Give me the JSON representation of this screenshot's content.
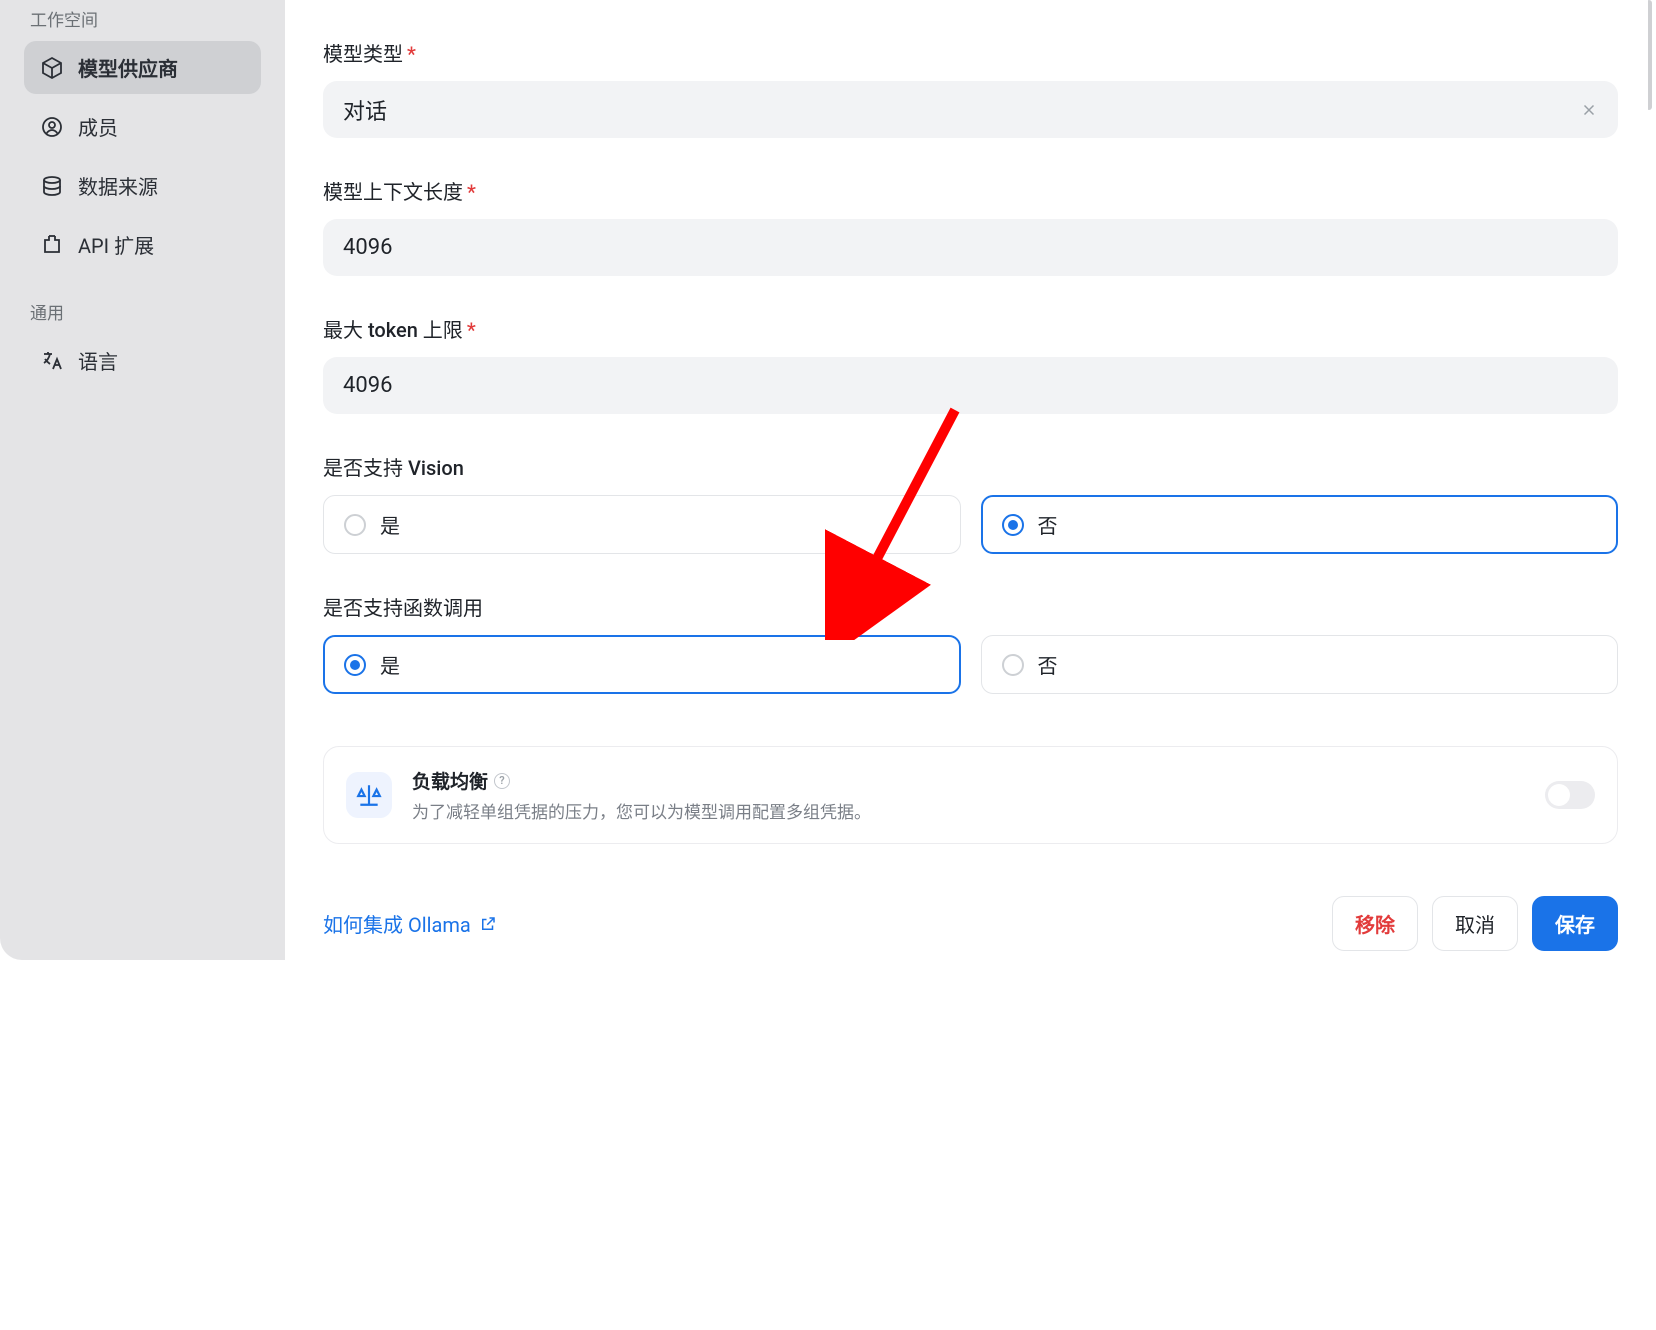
{
  "sidebar": {
    "section1_title": "工作空间",
    "section2_title": "通用",
    "items": [
      {
        "label": "模型供应商"
      },
      {
        "label": "成员"
      },
      {
        "label": "数据来源"
      },
      {
        "label": "API 扩展"
      },
      {
        "label": "语言"
      }
    ]
  },
  "form": {
    "model_type": {
      "label": "模型类型",
      "value": "对话",
      "required": true
    },
    "context_length": {
      "label": "模型上下文长度",
      "value": "4096",
      "required": true
    },
    "max_tokens": {
      "label": "最大 token 上限",
      "value": "4096",
      "required": true
    },
    "vision": {
      "label": "是否支持 Vision",
      "yes": "是",
      "no": "否",
      "selected": "no"
    },
    "function_call": {
      "label": "是否支持函数调用",
      "yes": "是",
      "no": "否",
      "selected": "yes"
    },
    "load_balance": {
      "title": "负载均衡",
      "desc": "为了减轻单组凭据的压力，您可以为模型调用配置多组凭据。",
      "enabled": false
    }
  },
  "footer": {
    "help_link": "如何集成 Ollama",
    "remove": "移除",
    "cancel": "取消",
    "save": "保存"
  }
}
